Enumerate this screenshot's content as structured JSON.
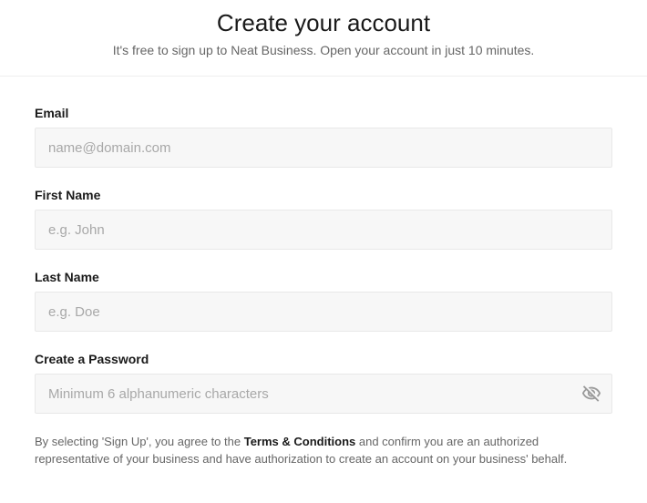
{
  "header": {
    "title": "Create your account",
    "subtitle": "It's free to sign up to Neat Business. Open your account in just 10 minutes."
  },
  "form": {
    "email": {
      "label": "Email",
      "placeholder": "name@domain.com",
      "value": ""
    },
    "first_name": {
      "label": "First Name",
      "placeholder": "e.g. John",
      "value": ""
    },
    "last_name": {
      "label": "Last Name",
      "placeholder": "e.g. Doe",
      "value": ""
    },
    "password": {
      "label": "Create a Password",
      "placeholder": "Minimum 6 alphanumeric characters",
      "value": ""
    }
  },
  "disclaimer": {
    "prefix": "By selecting 'Sign Up', you agree to the ",
    "terms_label": "Terms & Conditions",
    "suffix": " and confirm you are an authorized representative of your business and have authorization to create an account on your business' behalf."
  }
}
